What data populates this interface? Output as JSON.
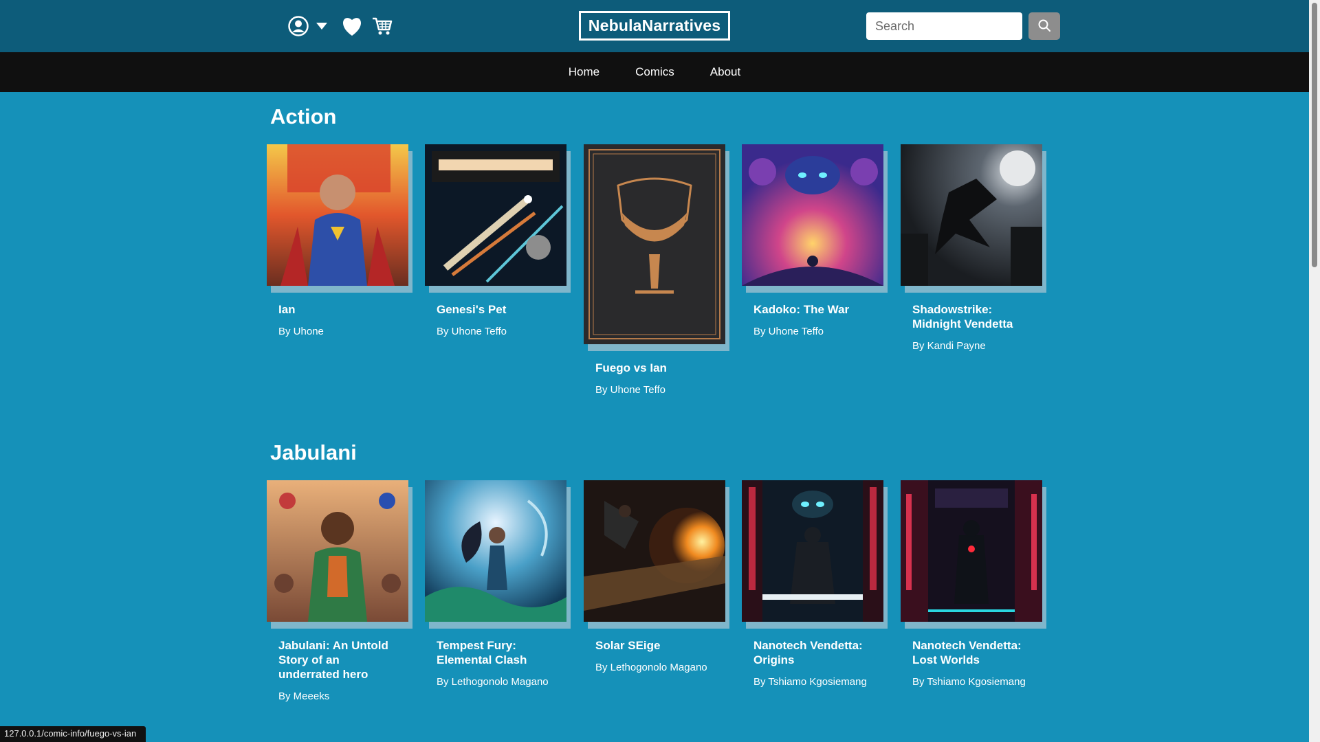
{
  "header": {
    "brand": "NebulaNarratives",
    "icons": [
      "user-circle-icon",
      "caret-down-icon",
      "heart-icon",
      "cart-icon"
    ],
    "search": {
      "placeholder": "Search",
      "value": ""
    },
    "colors": {
      "header_bg": "#0d5c7a",
      "nav_bg": "#101010",
      "page_bg": "#1591b9",
      "search_button": "#8d8d8d"
    }
  },
  "nav": {
    "items": [
      "Home",
      "Comics",
      "About"
    ]
  },
  "sections": [
    {
      "title": "Action",
      "comics": [
        {
          "title": "Ian",
          "author": "By Uhone"
        },
        {
          "title": "Genesi's Pet",
          "author": "By Uhone Teffo"
        },
        {
          "title": "Fuego vs Ian",
          "author": "By Uhone Teffo"
        },
        {
          "title": "Kadoko: The War",
          "author": "By Uhone Teffo"
        },
        {
          "title": "Shadowstrike: Midnight Vendetta",
          "author": "By Kandi Payne"
        }
      ]
    },
    {
      "title": "Jabulani",
      "comics": [
        {
          "title": "Jabulani: An Untold Story of an underrated hero",
          "author": "By Meeeks"
        },
        {
          "title": "Tempest Fury: Elemental Clash",
          "author": "By Lethogonolo Magano"
        },
        {
          "title": "Solar SEige",
          "author": "By Lethogonolo Magano"
        },
        {
          "title": "Nanotech Vendetta: Origins",
          "author": "By Tshiamo Kgosiemang"
        },
        {
          "title": "Nanotech Vendetta: Lost Worlds",
          "author": "By Tshiamo Kgosiemang"
        }
      ]
    }
  ],
  "status_url": "127.0.0.1/comic-info/fuego-vs-ian"
}
